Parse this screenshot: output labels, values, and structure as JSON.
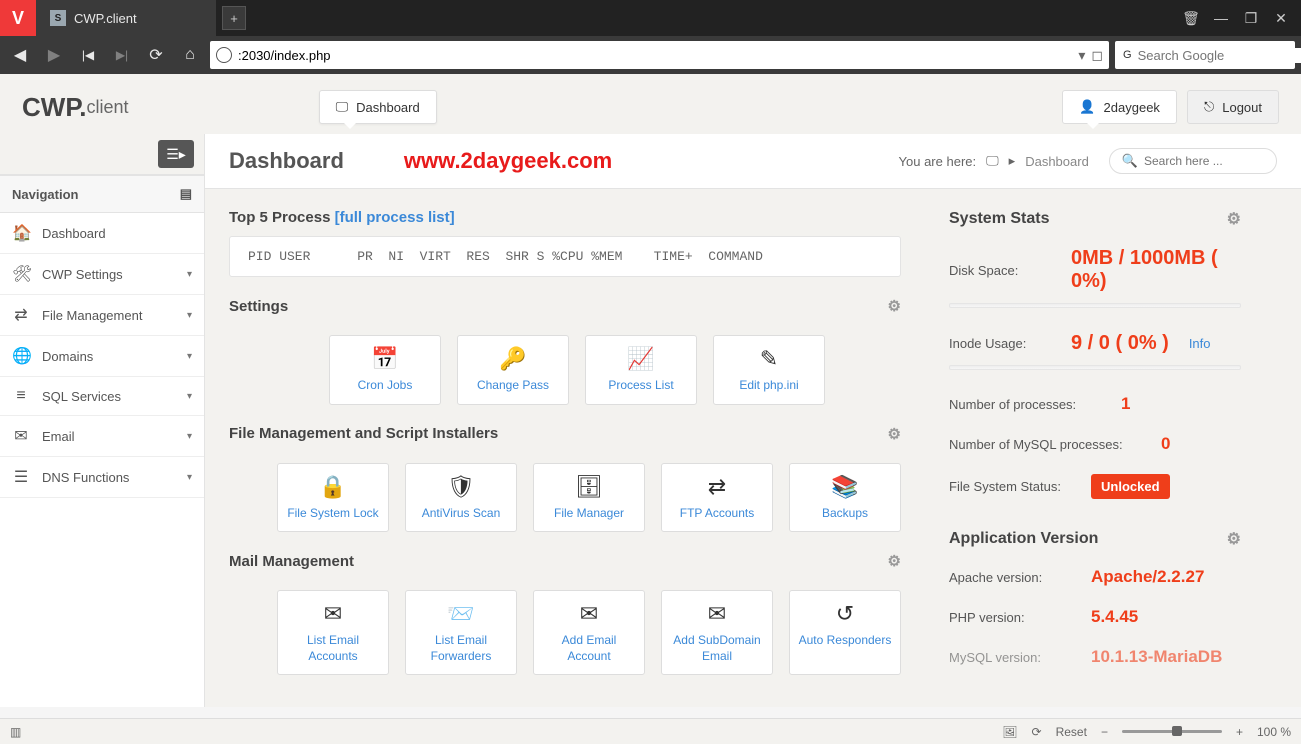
{
  "browser": {
    "tab_title": "CWP.client",
    "url": ":2030/index.php",
    "search_placeholder": "Search Google"
  },
  "header": {
    "logo_main": "CWP.",
    "logo_sub": "client",
    "dashboard_tab": "Dashboard",
    "username": "2daygeek",
    "logout": "Logout"
  },
  "page": {
    "title": "Dashboard",
    "watermark": "www.2daygeek.com",
    "breadcrumb_prefix": "You are here:",
    "breadcrumb_item": "Dashboard",
    "search_placeholder": "Search here ..."
  },
  "sidebar": {
    "header": "Navigation",
    "items": [
      {
        "icon": "home",
        "label": "Dashboard",
        "expandable": false
      },
      {
        "icon": "wrench",
        "label": "CWP Settings",
        "expandable": true
      },
      {
        "icon": "swap",
        "label": "File Management",
        "expandable": true
      },
      {
        "icon": "globe",
        "label": "Domains",
        "expandable": true
      },
      {
        "icon": "db",
        "label": "SQL Services",
        "expandable": true
      },
      {
        "icon": "mail",
        "label": "Email",
        "expandable": true
      },
      {
        "icon": "stack",
        "label": "DNS Functions",
        "expandable": true
      }
    ]
  },
  "process": {
    "title": "Top 5 Process",
    "link": "[full process list]",
    "header_row": "PID USER      PR  NI  VIRT  RES  SHR S %CPU %MEM    TIME+  COMMAND"
  },
  "sections": {
    "settings": {
      "title": "Settings",
      "tiles": [
        {
          "icon": "📅",
          "label": "Cron Jobs"
        },
        {
          "icon": "🔑",
          "label": "Change Pass"
        },
        {
          "icon": "📈",
          "label": "Process List"
        },
        {
          "icon": "✎",
          "label": "Edit php.ini"
        }
      ]
    },
    "files": {
      "title": "File Management and Script Installers",
      "tiles": [
        {
          "icon": "🔒",
          "label": "File System Lock"
        },
        {
          "icon": "🛡",
          "label": "AntiVirus Scan"
        },
        {
          "icon": "🗄",
          "label": "File Manager"
        },
        {
          "icon": "⇄",
          "label": "FTP Accounts"
        },
        {
          "icon": "📚",
          "label": "Backups"
        }
      ]
    },
    "mail": {
      "title": "Mail Management",
      "tiles": [
        {
          "icon": "✉",
          "label": "List Email Accounts"
        },
        {
          "icon": "📨",
          "label": "List Email Forwarders"
        },
        {
          "icon": "✉",
          "label": "Add Email Account"
        },
        {
          "icon": "✉",
          "label": "Add SubDomain Email"
        },
        {
          "icon": "↺",
          "label": "Auto Responders"
        }
      ]
    }
  },
  "stats": {
    "title": "System Stats",
    "disk_label": "Disk Space:",
    "disk_value": "0MB / 1000MB ( 0%)",
    "inode_label": "Inode Usage:",
    "inode_value": "9 / 0 ( 0% )",
    "info": "Info",
    "proc_label": "Number of processes:",
    "proc_value": "1",
    "mysql_label": "Number of MySQL processes:",
    "mysql_value": "0",
    "fs_label": "File System Status:",
    "fs_value": "Unlocked"
  },
  "appver": {
    "title": "Application Version",
    "apache_label": "Apache version:",
    "apache_value": "Apache/2.2.27",
    "php_label": "PHP version:",
    "php_value": "5.4.45",
    "mysql_label": "MySQL version:",
    "mysql_value": "10.1.13-MariaDB"
  },
  "statusbar": {
    "reset": "Reset",
    "zoom": "100 %"
  }
}
